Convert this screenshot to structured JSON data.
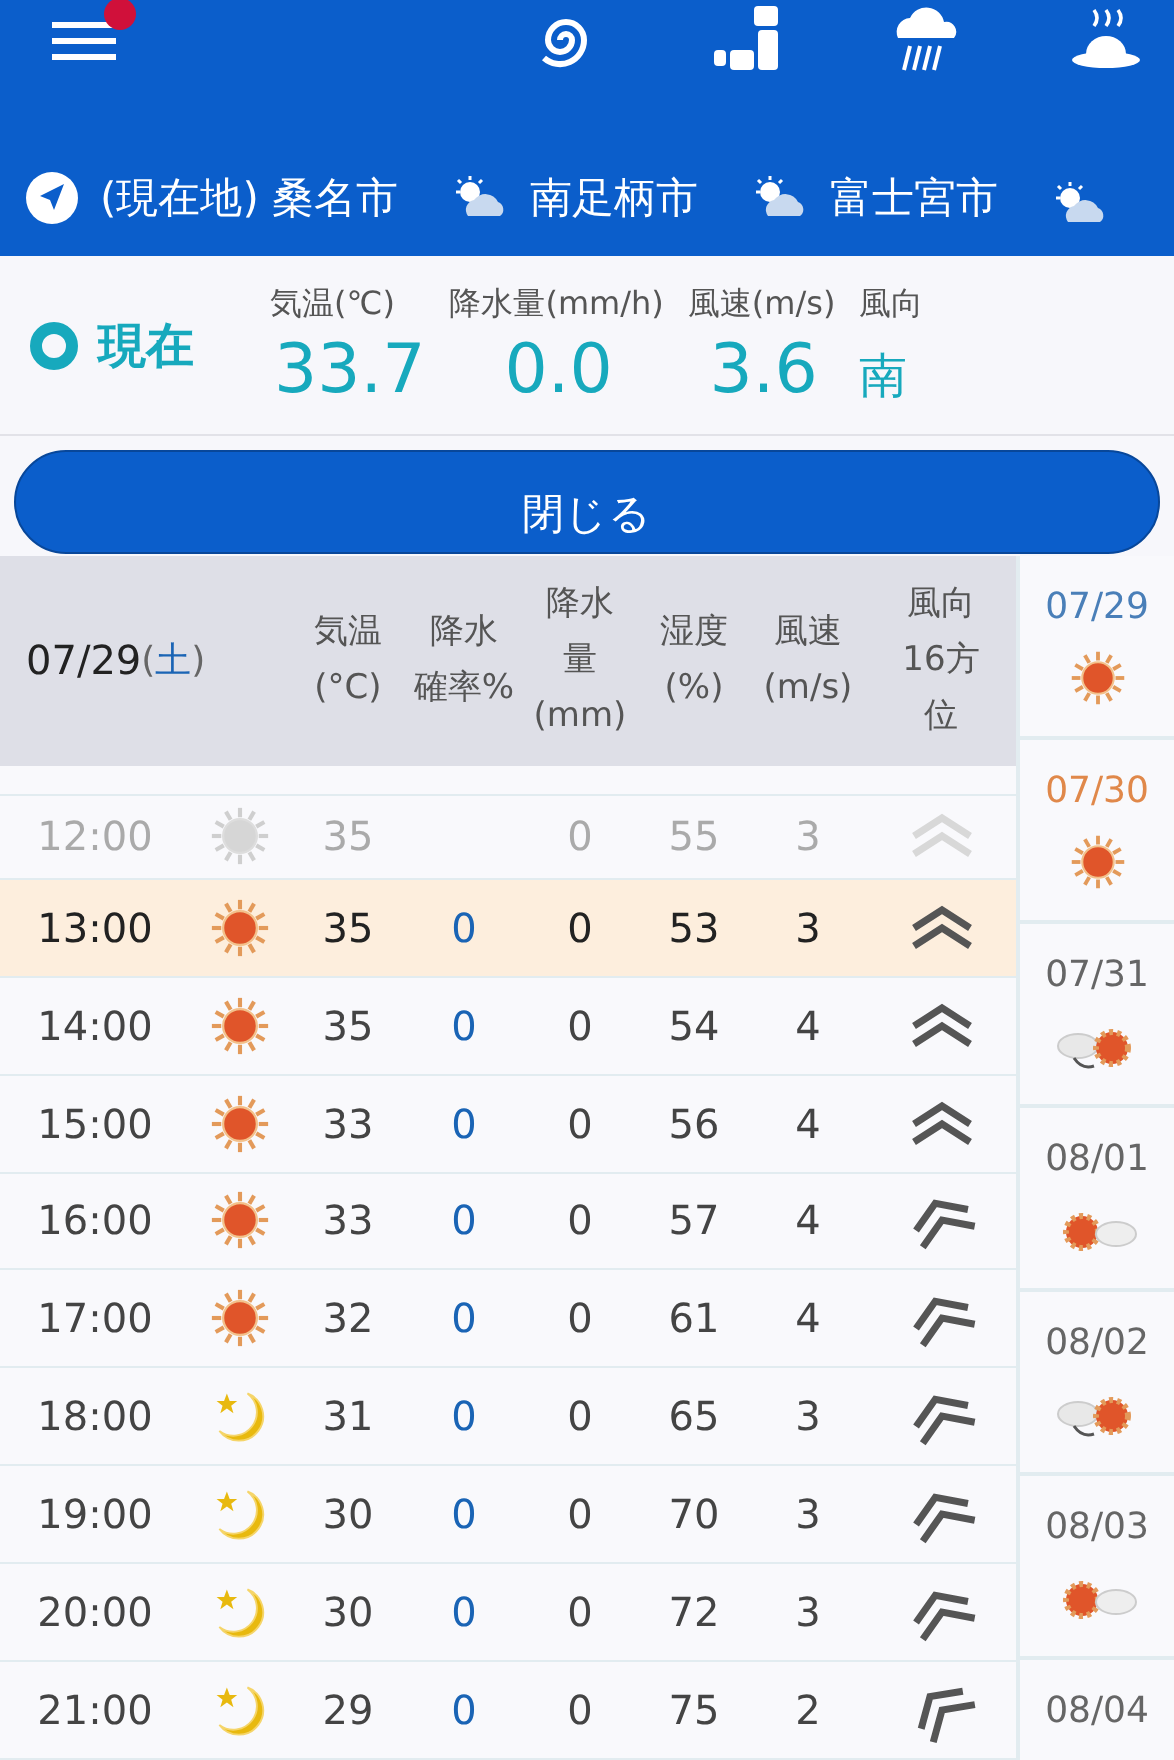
{
  "toolbar": {
    "menu_badge": true,
    "icons": [
      {
        "kind": "typhoon"
      },
      {
        "kind": "steps"
      },
      {
        "kind": "rain"
      },
      {
        "kind": "hotspring"
      }
    ]
  },
  "city_tabs": [
    {
      "kind": "location",
      "label": "(現在地) 桑名市"
    },
    {
      "kind": "weather",
      "label": "南足柄市"
    },
    {
      "kind": "weather",
      "label": "富士宮市"
    },
    {
      "kind": "weather"
    }
  ],
  "current": {
    "label": "現在",
    "fields": [
      {
        "label": "気温(℃)",
        "value": "33.7"
      },
      {
        "label": "降水量(mm/h)",
        "value": "0.0"
      },
      {
        "label": "風速(m/s)",
        "value": "3.6"
      },
      {
        "label": "風向",
        "value": "南",
        "kind": "direction"
      }
    ]
  },
  "close_button": "閉じる",
  "table": {
    "date": "07/29",
    "weekday_open": "(",
    "weekday": "土",
    "weekday_close": ")",
    "columns": [
      [
        "気温",
        "(°C)"
      ],
      [
        "降水",
        "確率%"
      ],
      [
        "降水",
        "量",
        "(mm)"
      ],
      [
        "湿度",
        "(%)"
      ],
      [
        "風速",
        "(m/s)"
      ],
      [
        "風向",
        "16方",
        "位"
      ]
    ],
    "rows": [
      {
        "time": "12:00",
        "weather": {
          "kind": "sun"
        },
        "temp": "35",
        "rain": "0",
        "humidity": "55",
        "wind": "3",
        "arrow": {
          "kind": "N"
        },
        "past": true,
        "selected": false
      },
      {
        "time": "13:00",
        "weather": {
          "kind": "sun"
        },
        "temp": "35",
        "prob": "0",
        "rain": "0",
        "humidity": "53",
        "wind": "3",
        "arrow": {
          "kind": "N"
        },
        "past": false,
        "selected": true
      },
      {
        "time": "14:00",
        "weather": {
          "kind": "sun"
        },
        "temp": "35",
        "prob": "0",
        "rain": "0",
        "humidity": "54",
        "wind": "4",
        "arrow": {
          "kind": "N"
        },
        "past": false,
        "selected": false
      },
      {
        "time": "15:00",
        "weather": {
          "kind": "sun"
        },
        "temp": "33",
        "prob": "0",
        "rain": "0",
        "humidity": "56",
        "wind": "4",
        "arrow": {
          "kind": "N"
        },
        "past": false,
        "selected": false
      },
      {
        "time": "16:00",
        "weather": {
          "kind": "sun"
        },
        "temp": "33",
        "prob": "0",
        "rain": "0",
        "humidity": "57",
        "wind": "4",
        "arrow": {
          "kind": "NNW"
        },
        "past": false,
        "selected": false
      },
      {
        "time": "17:00",
        "weather": {
          "kind": "sun"
        },
        "temp": "32",
        "prob": "0",
        "rain": "0",
        "humidity": "61",
        "wind": "4",
        "arrow": {
          "kind": "NNW"
        },
        "past": false,
        "selected": false
      },
      {
        "time": "18:00",
        "weather": {
          "kind": "moon"
        },
        "temp": "31",
        "prob": "0",
        "rain": "0",
        "humidity": "65",
        "wind": "3",
        "arrow": {
          "kind": "NNW"
        },
        "past": false,
        "selected": false
      },
      {
        "time": "19:00",
        "weather": {
          "kind": "moon"
        },
        "temp": "30",
        "prob": "0",
        "rain": "0",
        "humidity": "70",
        "wind": "3",
        "arrow": {
          "kind": "NNW"
        },
        "past": false,
        "selected": false
      },
      {
        "time": "20:00",
        "weather": {
          "kind": "moon"
        },
        "temp": "30",
        "prob": "0",
        "rain": "0",
        "humidity": "72",
        "wind": "3",
        "arrow": {
          "kind": "NNW"
        },
        "past": false,
        "selected": false
      },
      {
        "time": "21:00",
        "weather": {
          "kind": "moon"
        },
        "temp": "29",
        "prob": "0",
        "rain": "0",
        "humidity": "75",
        "wind": "2",
        "arrow": {
          "kind": "NW"
        },
        "past": false,
        "selected": false
      }
    ]
  },
  "days": [
    {
      "date": "07/29",
      "color": "#4a7fb8",
      "weather": {
        "kind": "sun"
      }
    },
    {
      "date": "07/30",
      "color": "#e0884a",
      "weather": {
        "kind": "sun"
      }
    },
    {
      "date": "07/31",
      "color": "#666666",
      "weather": {
        "kind": "cloud_sun"
      }
    },
    {
      "date": "08/01",
      "color": "#666666",
      "weather": {
        "kind": "sun_cloud"
      }
    },
    {
      "date": "08/02",
      "color": "#666666",
      "weather": {
        "kind": "cloud_sun"
      }
    },
    {
      "date": "08/03",
      "color": "#666666",
      "weather": {
        "kind": "sun_cloud"
      }
    },
    {
      "date": "08/04",
      "color": "#666666"
    }
  ]
}
